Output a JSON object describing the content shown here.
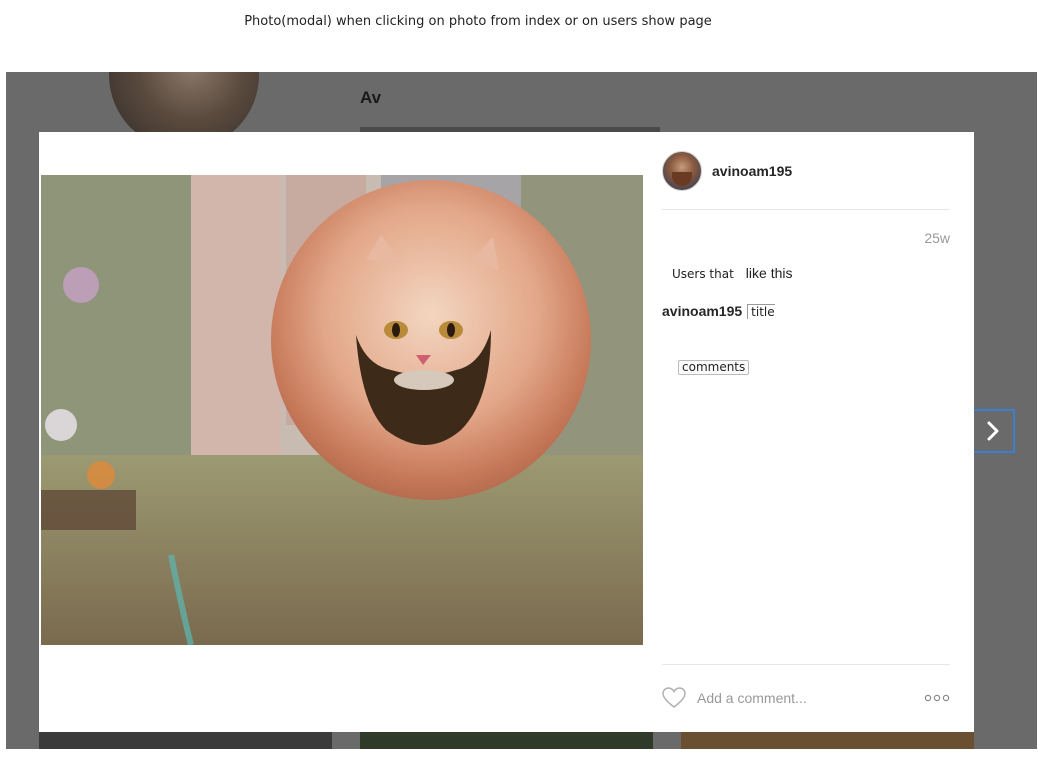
{
  "page_caption": "Photo(modal) when clicking on photo from index or on users show page",
  "background_profile": {
    "username": "Av"
  },
  "modal": {
    "photo_alt": "Bearded cat photo",
    "author": {
      "username": "avinoam195"
    },
    "time_ago": "25w",
    "likes": {
      "prefix": "Users that",
      "suffix": "like this"
    },
    "caption": {
      "username": "avinoam195",
      "title": "title"
    },
    "comments_label": "comments",
    "comment_input": {
      "placeholder": "Add a comment..."
    }
  },
  "icons": {
    "like": "heart-icon",
    "more": "more-options-icon",
    "next": "chevron-right-icon"
  },
  "colors": {
    "backdrop": "#6a6a6a",
    "accent": "#3b7fd0",
    "muted_text": "#999999"
  }
}
